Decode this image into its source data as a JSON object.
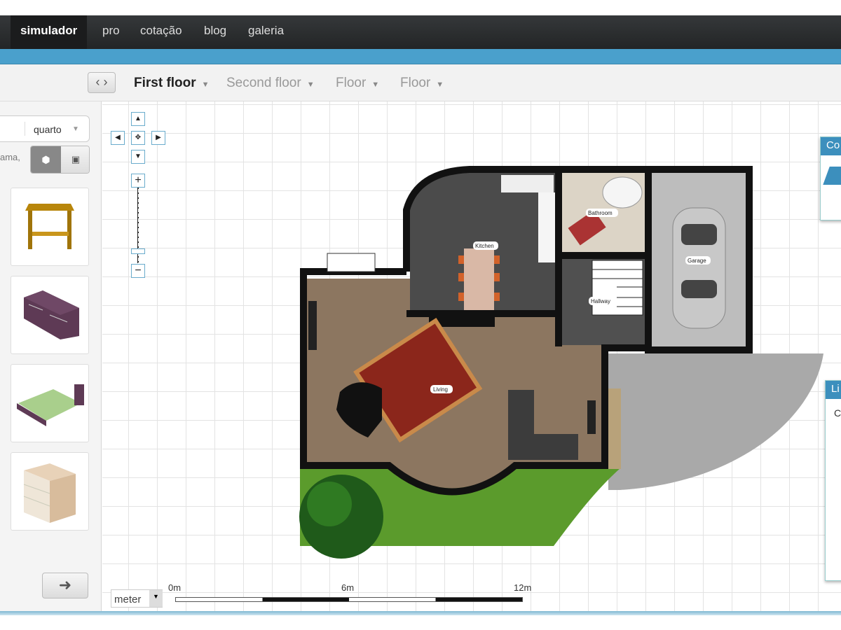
{
  "nav": {
    "items": [
      {
        "label": "simulador",
        "active": true
      },
      {
        "label": "pro"
      },
      {
        "label": "cotação"
      },
      {
        "label": "blog"
      },
      {
        "label": "galeria"
      }
    ]
  },
  "toolbar": {
    "floors": [
      {
        "label": "First floor",
        "active": true
      },
      {
        "label": "Second floor"
      },
      {
        "label": "Floor"
      },
      {
        "label": "Floor"
      }
    ],
    "collapse_icon": "chevron-left-right-icon"
  },
  "sidebar": {
    "category_select": "quarto",
    "search_hint": "ama,",
    "view_toggle": [
      "3d-view",
      "2d-view"
    ],
    "items": [
      {
        "name": "nightstand"
      },
      {
        "name": "sideboard"
      },
      {
        "name": "double-bed"
      },
      {
        "name": "dresser"
      }
    ],
    "next_icon": "arrow-right-icon"
  },
  "plan": {
    "rooms": {
      "kitchen": "Kitchen",
      "bathroom": "Bathroom",
      "hallway": "Hallway",
      "garage": "Garage",
      "living": "Living"
    }
  },
  "scale": {
    "unit": "meter",
    "ticks": [
      "0m",
      "6m",
      "12m"
    ]
  },
  "panels": {
    "top_title": "Co",
    "bottom_title": "Li",
    "bottom_text": "C"
  },
  "colors": {
    "nav": "#2b2d2e",
    "accent": "#4aa0cc",
    "wall": "#111111",
    "wood": "#8c7660",
    "tile": "#4b4b4b",
    "grass": "#5b9b2c",
    "gravel": "#a9a9a9"
  }
}
